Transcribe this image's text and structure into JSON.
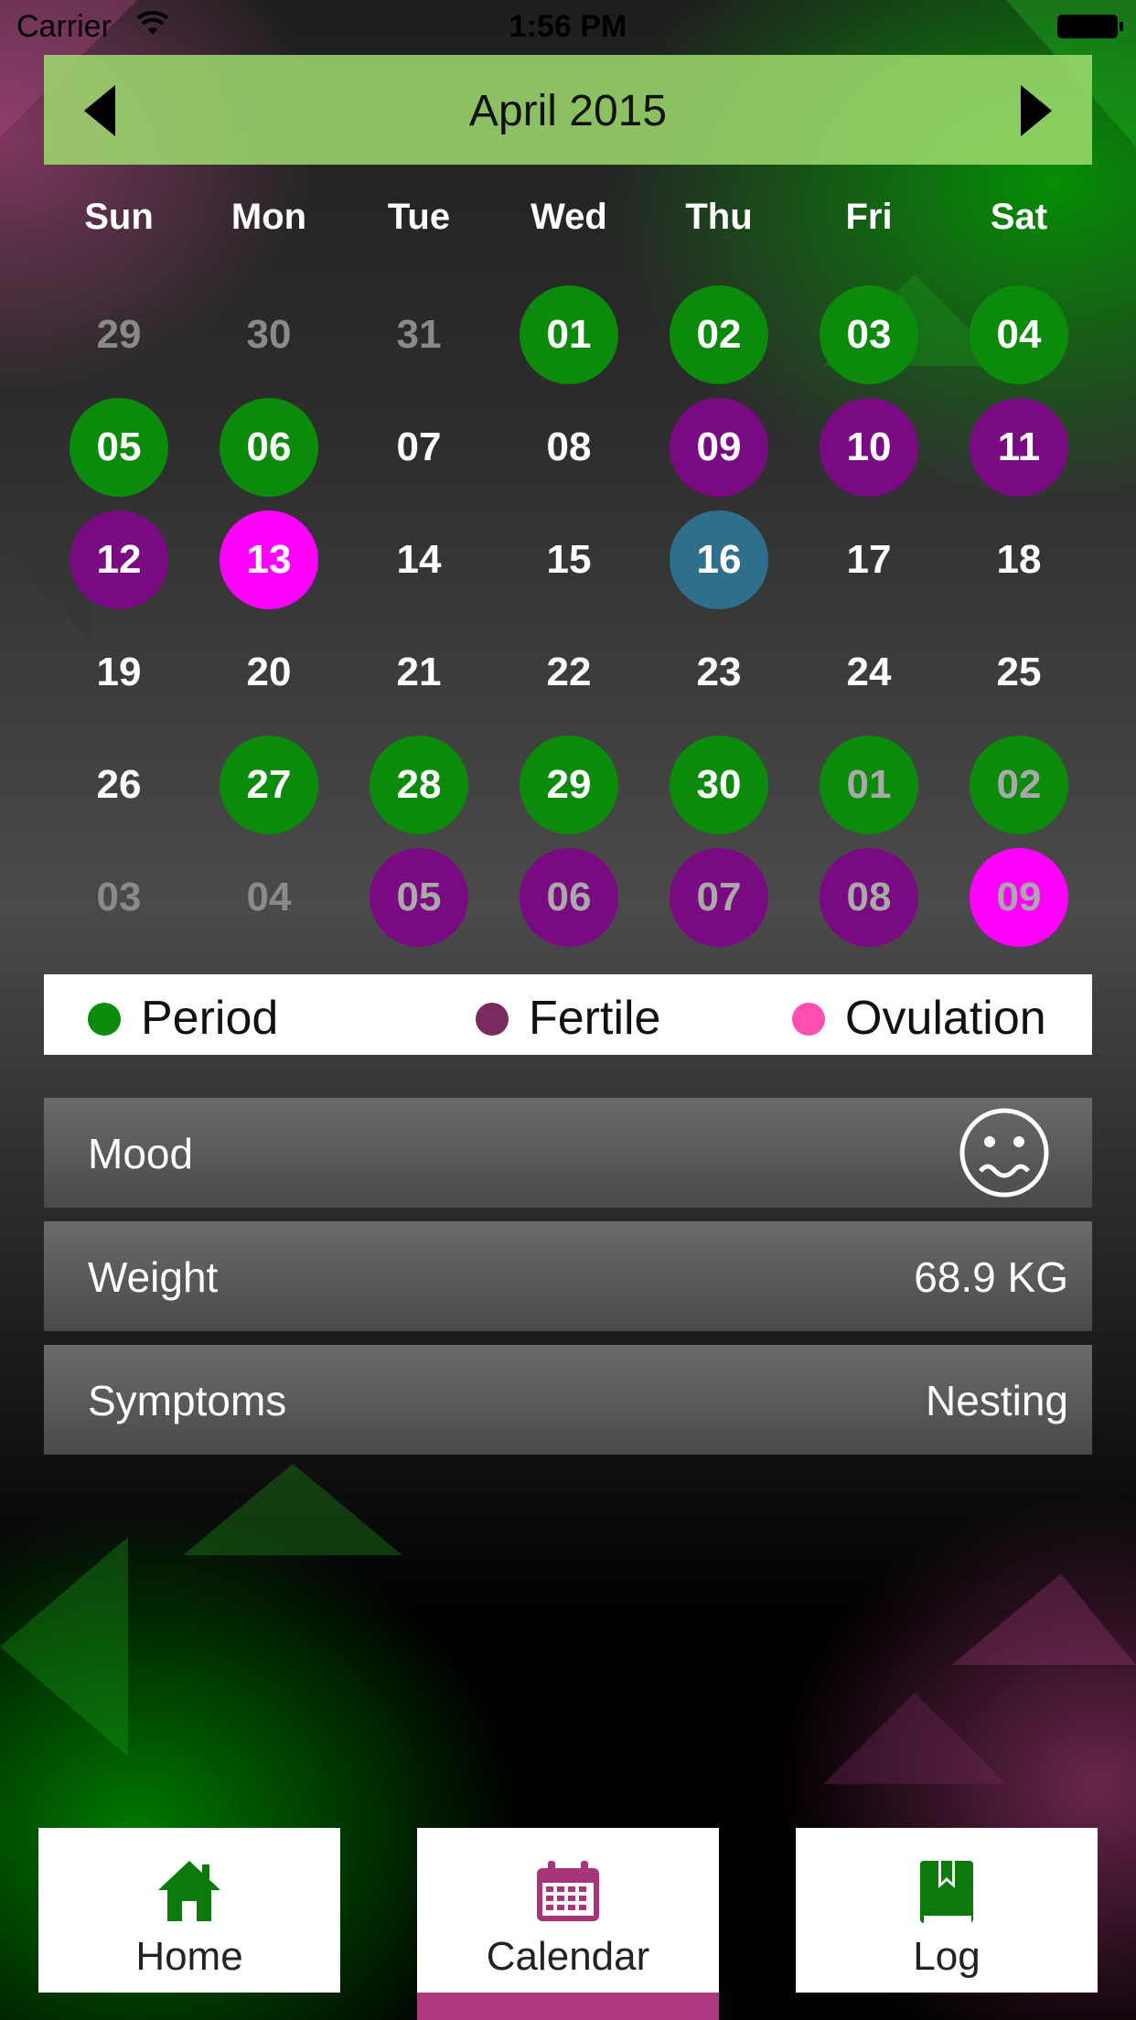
{
  "status_bar": {
    "carrier": "Carrier",
    "time": "1:56 PM"
  },
  "calendar": {
    "month_title": "April 2015",
    "weekdays": [
      "Sun",
      "Mon",
      "Tue",
      "Wed",
      "Thu",
      "Fri",
      "Sat"
    ],
    "weeks": [
      [
        {
          "d": "29",
          "other": true,
          "type": ""
        },
        {
          "d": "30",
          "other": true,
          "type": ""
        },
        {
          "d": "31",
          "other": true,
          "type": ""
        },
        {
          "d": "01",
          "type": "period"
        },
        {
          "d": "02",
          "type": "period"
        },
        {
          "d": "03",
          "type": "period"
        },
        {
          "d": "04",
          "type": "period"
        }
      ],
      [
        {
          "d": "05",
          "type": "period"
        },
        {
          "d": "06",
          "type": "period"
        },
        {
          "d": "07",
          "type": ""
        },
        {
          "d": "08",
          "type": ""
        },
        {
          "d": "09",
          "type": "fertile"
        },
        {
          "d": "10",
          "type": "fertile"
        },
        {
          "d": "11",
          "type": "fertile"
        }
      ],
      [
        {
          "d": "12",
          "type": "fertile"
        },
        {
          "d": "13",
          "type": "ovulation"
        },
        {
          "d": "14",
          "type": ""
        },
        {
          "d": "15",
          "type": ""
        },
        {
          "d": "16",
          "type": "today"
        },
        {
          "d": "17",
          "type": ""
        },
        {
          "d": "18",
          "type": ""
        }
      ],
      [
        {
          "d": "19",
          "type": ""
        },
        {
          "d": "20",
          "type": ""
        },
        {
          "d": "21",
          "type": ""
        },
        {
          "d": "22",
          "type": ""
        },
        {
          "d": "23",
          "type": ""
        },
        {
          "d": "24",
          "type": ""
        },
        {
          "d": "25",
          "type": ""
        }
      ],
      [
        {
          "d": "26",
          "type": ""
        },
        {
          "d": "27",
          "type": "period"
        },
        {
          "d": "28",
          "type": "period"
        },
        {
          "d": "29",
          "type": "period"
        },
        {
          "d": "30",
          "type": "period"
        },
        {
          "d": "01",
          "other": true,
          "type": "period"
        },
        {
          "d": "02",
          "other": true,
          "type": "period"
        }
      ],
      [
        {
          "d": "03",
          "other": true,
          "type": ""
        },
        {
          "d": "04",
          "other": true,
          "type": ""
        },
        {
          "d": "05",
          "other": true,
          "type": "fertile"
        },
        {
          "d": "06",
          "other": true,
          "type": "fertile"
        },
        {
          "d": "07",
          "other": true,
          "type": "fertile"
        },
        {
          "d": "08",
          "other": true,
          "type": "fertile"
        },
        {
          "d": "09",
          "other": true,
          "type": "ovulation"
        }
      ]
    ]
  },
  "legend": {
    "period": {
      "label": "Period",
      "color": "#0b8a0b"
    },
    "fertile": {
      "label": "Fertile",
      "color": "#7a2a5e"
    },
    "ovulation": {
      "label": "Ovulation",
      "color": "#ff4fb3"
    }
  },
  "details": {
    "mood_label": "Mood",
    "mood_icon": "worried-face-icon",
    "weight_label": "Weight",
    "weight_value": "68.9 KG",
    "symptoms_label": "Symptoms",
    "symptoms_value": "Nesting"
  },
  "tabs": {
    "home": {
      "label": "Home",
      "icon": "home-icon",
      "color": "#0b7a0b"
    },
    "calendar": {
      "label": "Calendar",
      "icon": "calendar-icon",
      "color": "#a8357a",
      "active": true
    },
    "log": {
      "label": "Log",
      "icon": "bookmark-book-icon",
      "color": "#0b7a0b"
    }
  }
}
